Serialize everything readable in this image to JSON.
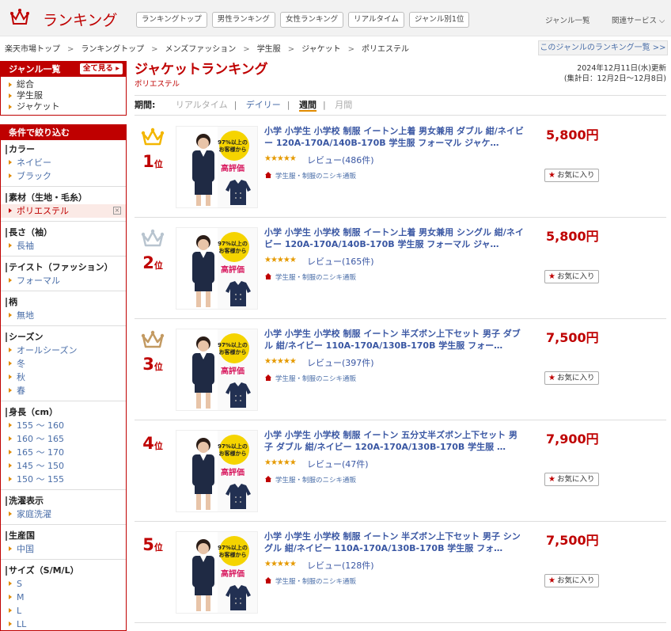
{
  "header": {
    "title": "ランキング",
    "nav": [
      "ランキングトップ",
      "男性ランキング",
      "女性ランキング",
      "リアルタイム",
      "ジャンル別1位"
    ],
    "genre_list": "ジャンル一覧",
    "related": "関連サービス ⌵"
  },
  "breadcrumb": [
    "楽天市場トップ",
    "ランキングトップ",
    "メンズファッション",
    "学生服",
    "ジャケット",
    "ポリエステル"
  ],
  "genre_ranking_link": "このジャンルのランキング一覧 >>",
  "sidebar": {
    "genre_head": "ジャンル一覧",
    "see_all": "全て見る",
    "genres": [
      "総合",
      "学生服",
      "ジャケット"
    ],
    "filter_head": "条件で絞り込む",
    "filters": [
      {
        "label": "カラー",
        "options": [
          "ネイビー",
          "ブラック"
        ]
      },
      {
        "label": "素材（生地・毛糸）",
        "options": [
          "ポリエステル"
        ],
        "selected": "ポリエステル"
      },
      {
        "label": "長さ（袖）",
        "options": [
          "長袖"
        ]
      },
      {
        "label": "テイスト（ファッション）",
        "options": [
          "フォーマル"
        ]
      },
      {
        "label": "柄",
        "options": [
          "無地"
        ]
      },
      {
        "label": "シーズン",
        "options": [
          "オールシーズン",
          "冬",
          "秋",
          "春"
        ]
      },
      {
        "label": "身長（cm）",
        "options": [
          "155 ～ 160",
          "160 ～ 165",
          "165 ～ 170",
          "145 ～ 150",
          "150 ～ 155"
        ]
      },
      {
        "label": "洗濯表示",
        "options": [
          "家庭洗濯"
        ]
      },
      {
        "label": "生産国",
        "options": [
          "中国"
        ]
      },
      {
        "label": "サイズ（S/M/L）",
        "options": [
          "S",
          "M",
          "L",
          "LL"
        ]
      }
    ],
    "clear_symbol": "×"
  },
  "main": {
    "title": "ジャケットランキング",
    "subtitle": "ポリエステル",
    "updated": "2024年12月11日(水)更新",
    "period_range": "(集計日：12月2日～12月8日)",
    "period_label": "期間:",
    "periods": [
      "リアルタイム",
      "デイリー",
      "週間",
      "月間"
    ],
    "period_current": "週間",
    "thumb_badge": {
      "line1": "97%以上の",
      "line2": "お客様から",
      "big": "高評価"
    },
    "items": [
      {
        "rank": "1",
        "rank_suffix": "位",
        "crown": "gold",
        "title": "小学 小学生 小学校 制服 イートン上着 男女兼用 ダブル 紺/ネイビー 120A-170A/140B-170B 学生服 フォーマル ジャケ…",
        "stars": "★★★★★",
        "rating": 4.5,
        "reviews": "レビュー(486件)",
        "shop": "学生服・制服のニシキ通販",
        "price": "5,800円",
        "fav": "お気に入り"
      },
      {
        "rank": "2",
        "rank_suffix": "位",
        "crown": "silver",
        "title": "小学 小学生 小学校 制服 イートン上着 男女兼用 シングル 紺/ネイビー 120A-170A/140B-170B 学生服 フォーマル ジャ…",
        "stars": "★★★★★",
        "rating": 4.5,
        "reviews": "レビュー(165件)",
        "shop": "学生服・制服のニシキ通販",
        "price": "5,800円",
        "fav": "お気に入り"
      },
      {
        "rank": "3",
        "rank_suffix": "位",
        "crown": "bronze",
        "title": "小学 小学生 小学校 制服 イートン 半ズボン上下セット 男子 ダブル 紺/ネイビー 110A-170A/130B-170B 学生服 フォー…",
        "stars": "★★★★★",
        "rating": 4.5,
        "reviews": "レビュー(397件)",
        "shop": "学生服・制服のニシキ通販",
        "price": "7,500円",
        "fav": "お気に入り"
      },
      {
        "rank": "4",
        "rank_suffix": "位",
        "crown": "none",
        "title": "小学 小学生 小学校 制服 イートン 五分丈半ズボン上下セット 男子 ダブル 紺/ネイビー 120A-170A/130B-170B 学生服 …",
        "stars": "★★★★★",
        "rating": 4.5,
        "reviews": "レビュー(47件)",
        "shop": "学生服・制服のニシキ通販",
        "price": "7,900円",
        "fav": "お気に入り"
      },
      {
        "rank": "5",
        "rank_suffix": "位",
        "crown": "none",
        "title": "小学 小学生 小学校 制服 イートン 半ズボン上下セット 男子 シングル 紺/ネイビー 110A-170A/130B-170B 学生服 フォ…",
        "stars": "★★★★★",
        "rating": 4.5,
        "reviews": "レビュー(128件)",
        "shop": "学生服・制服のニシキ通販",
        "price": "7,500円",
        "fav": "お気に入り"
      }
    ]
  },
  "colors": {
    "brand": "#bf0000",
    "link": "#3a57a3",
    "gold": "#f3b600",
    "silver": "#b8c4cf",
    "bronze": "#c39a62",
    "accent": "#e08a00"
  }
}
